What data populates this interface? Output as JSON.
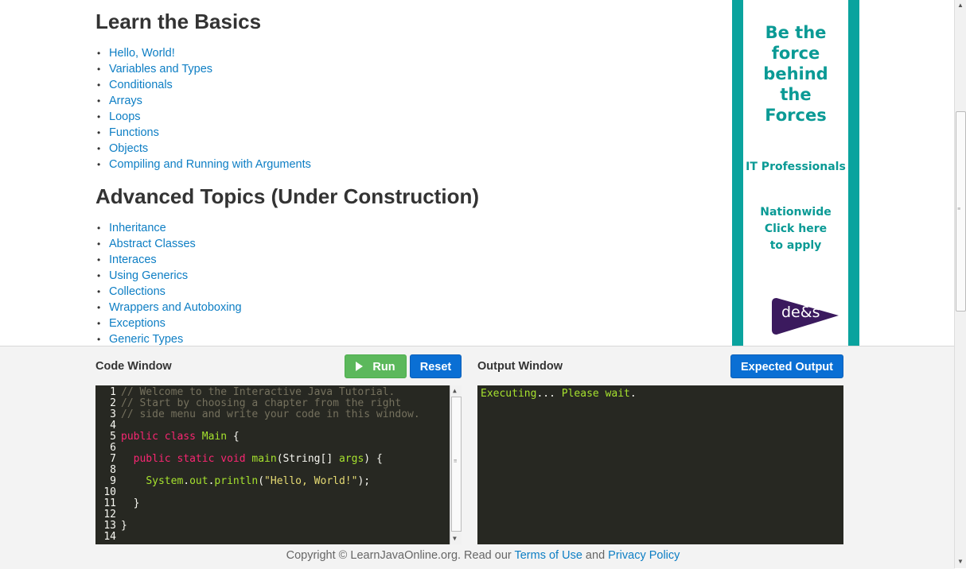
{
  "sections": [
    {
      "title": "Learn the Basics",
      "items": [
        "Hello, World!",
        "Variables and Types",
        "Conditionals",
        "Arrays",
        "Loops",
        "Functions",
        "Objects",
        "Compiling and Running with Arguments"
      ]
    },
    {
      "title": "Advanced Topics (Under Construction)",
      "items": [
        "Inheritance",
        "Abstract Classes",
        "Interaces",
        "Using Generics",
        "Collections",
        "Wrappers and Autoboxing",
        "Exceptions",
        "Generic Types"
      ]
    }
  ],
  "ad": {
    "headline_lines": [
      "Be the",
      "force",
      "behind",
      "the",
      "Forces"
    ],
    "subhead": "IT Professionals",
    "cta_lines": [
      "Nationwide",
      "Click here",
      "to apply"
    ],
    "logo_text": "de&s",
    "colors": {
      "teal": "#0aa39e",
      "logo_purple": "#3b1a5e"
    }
  },
  "code_window": {
    "title": "Code Window",
    "run_label": "Run",
    "reset_label": "Reset",
    "line_numbers": [
      "1",
      "2",
      "3",
      "4",
      "5",
      "6",
      "7",
      "8",
      "9",
      "10",
      "11",
      "12",
      "13",
      "14"
    ],
    "lines": [
      "// Welcome to the Interactive Java Tutorial.",
      "// Start by choosing a chapter from the right",
      "// side menu and write your code in this window.",
      "",
      "public class Main {",
      "",
      "  public static void main(String[] args) {",
      "",
      "    System.out.println(\"Hello, World!\");",
      "",
      "  }",
      "",
      "}",
      ""
    ]
  },
  "output_window": {
    "title": "Output Window",
    "expected_label": "Expected Output",
    "executing": "Executing",
    "dots": "...",
    "please": "Please wait",
    "period": "."
  },
  "footer": {
    "prefix": "Copyright © LearnJavaOnline.org. Read our ",
    "terms": "Terms of Use",
    "and": " and ",
    "privacy": "Privacy Policy"
  },
  "colors": {
    "link": "#0d7ec4",
    "run_green": "#5cb85c",
    "button_blue": "#0a6fd4",
    "editor_bg": "#272822"
  }
}
